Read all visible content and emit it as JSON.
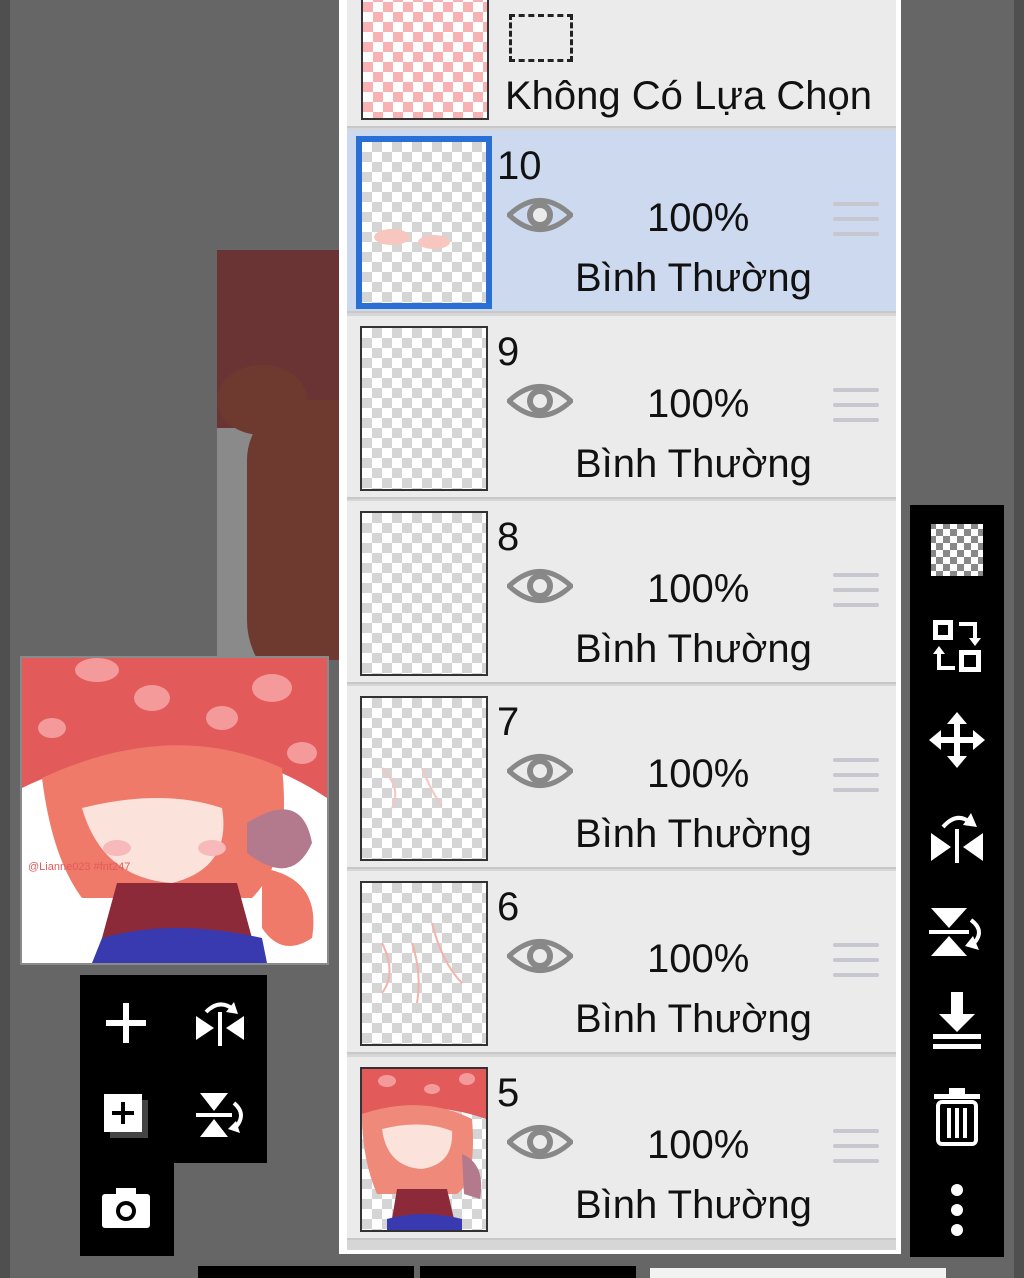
{
  "selection": {
    "label": "Không Có Lựa Chọn"
  },
  "layers": [
    {
      "number": "10",
      "opacity": "100%",
      "mode": "Bình Thường",
      "selected": true
    },
    {
      "number": "9",
      "opacity": "100%",
      "mode": "Bình Thường",
      "selected": false
    },
    {
      "number": "8",
      "opacity": "100%",
      "mode": "Bình Thường",
      "selected": false
    },
    {
      "number": "7",
      "opacity": "100%",
      "mode": "Bình Thường",
      "selected": false
    },
    {
      "number": "6",
      "opacity": "100%",
      "mode": "Bình Thường",
      "selected": false
    },
    {
      "number": "5",
      "opacity": "100%",
      "mode": "Bình Thường",
      "selected": false
    }
  ],
  "preview": {
    "watermark": "@Lianne023 #fnt247"
  },
  "colors": {
    "selected_row": "#ccd9ee",
    "selected_border": "#2a6fd6",
    "panel_row": "#ebebeb",
    "toolbar": "#000000"
  },
  "left_tools": [
    "add-layer-icon",
    "flip-horizontal-icon",
    "add-layer-copy-icon",
    "flip-vertical-icon",
    "camera-icon"
  ],
  "right_tools": [
    "transparency-icon",
    "swap-layer-icon",
    "move-icon",
    "flip-horizontal-icon",
    "flip-vertical-icon",
    "merge-down-icon",
    "trash-icon",
    "more-icon"
  ]
}
